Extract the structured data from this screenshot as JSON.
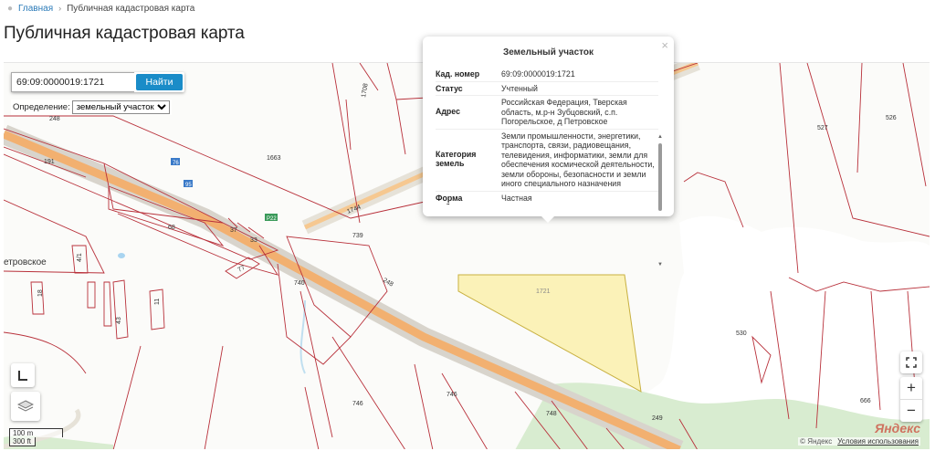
{
  "breadcrumb": {
    "home": "Главная",
    "current": "Публичная кадастровая карта"
  },
  "page_title": "Публичная кадастровая карта",
  "search": {
    "value": "69:09:0000019:1721",
    "button": "Найти"
  },
  "definition": {
    "label": "Определение:",
    "selected": "земельный участок"
  },
  "popup": {
    "title": "Земельный участок",
    "rows": [
      {
        "label": "Кад. номер",
        "value": "69:09:0000019:1721"
      },
      {
        "label": "Статус",
        "value": "Учтенный"
      },
      {
        "label": "Адрес",
        "value": "Российская Федерация, Тверская область, м.р-н Зубцовский, с.п. Погорельское, д Петровское"
      },
      {
        "label": "Категория земель",
        "value": "Земли промышленности, энергетики, транспорта, связи, радиовещания, телевидения, информатики, земли для обеспечения космической деятельности, земли обороны, безопасности и земли иного специального назначения"
      },
      {
        "label": "Форма собственности",
        "value": "Частная"
      }
    ]
  },
  "map": {
    "parcel_labels": [
      "248",
      "191",
      "1663",
      "68",
      "37",
      "33",
      "739",
      "1744",
      "740",
      "4/1",
      "18",
      "43",
      "11",
      "77",
      "746",
      "746",
      "748",
      "1708",
      "527",
      "526",
      "530",
      "666",
      "249",
      "1721"
    ],
    "road_labels": [
      "76",
      "95",
      "Р22",
      "248"
    ],
    "village_fragment": "етровское"
  },
  "scale": {
    "metric": "100 m",
    "imperial": "300 ft"
  },
  "zoom": {
    "in": "+",
    "out": "−"
  },
  "attribution": {
    "copyright": "© Яндекс",
    "terms": "Условия использования",
    "logo": "Яндекс"
  },
  "colors": {
    "parcel_border": "#b8303a",
    "road": "#f0a860",
    "selected_parcel": "#fbf2b8",
    "forest": "#d8ecd0",
    "water": "#a8d4f0",
    "button": "#1a8cc8"
  }
}
